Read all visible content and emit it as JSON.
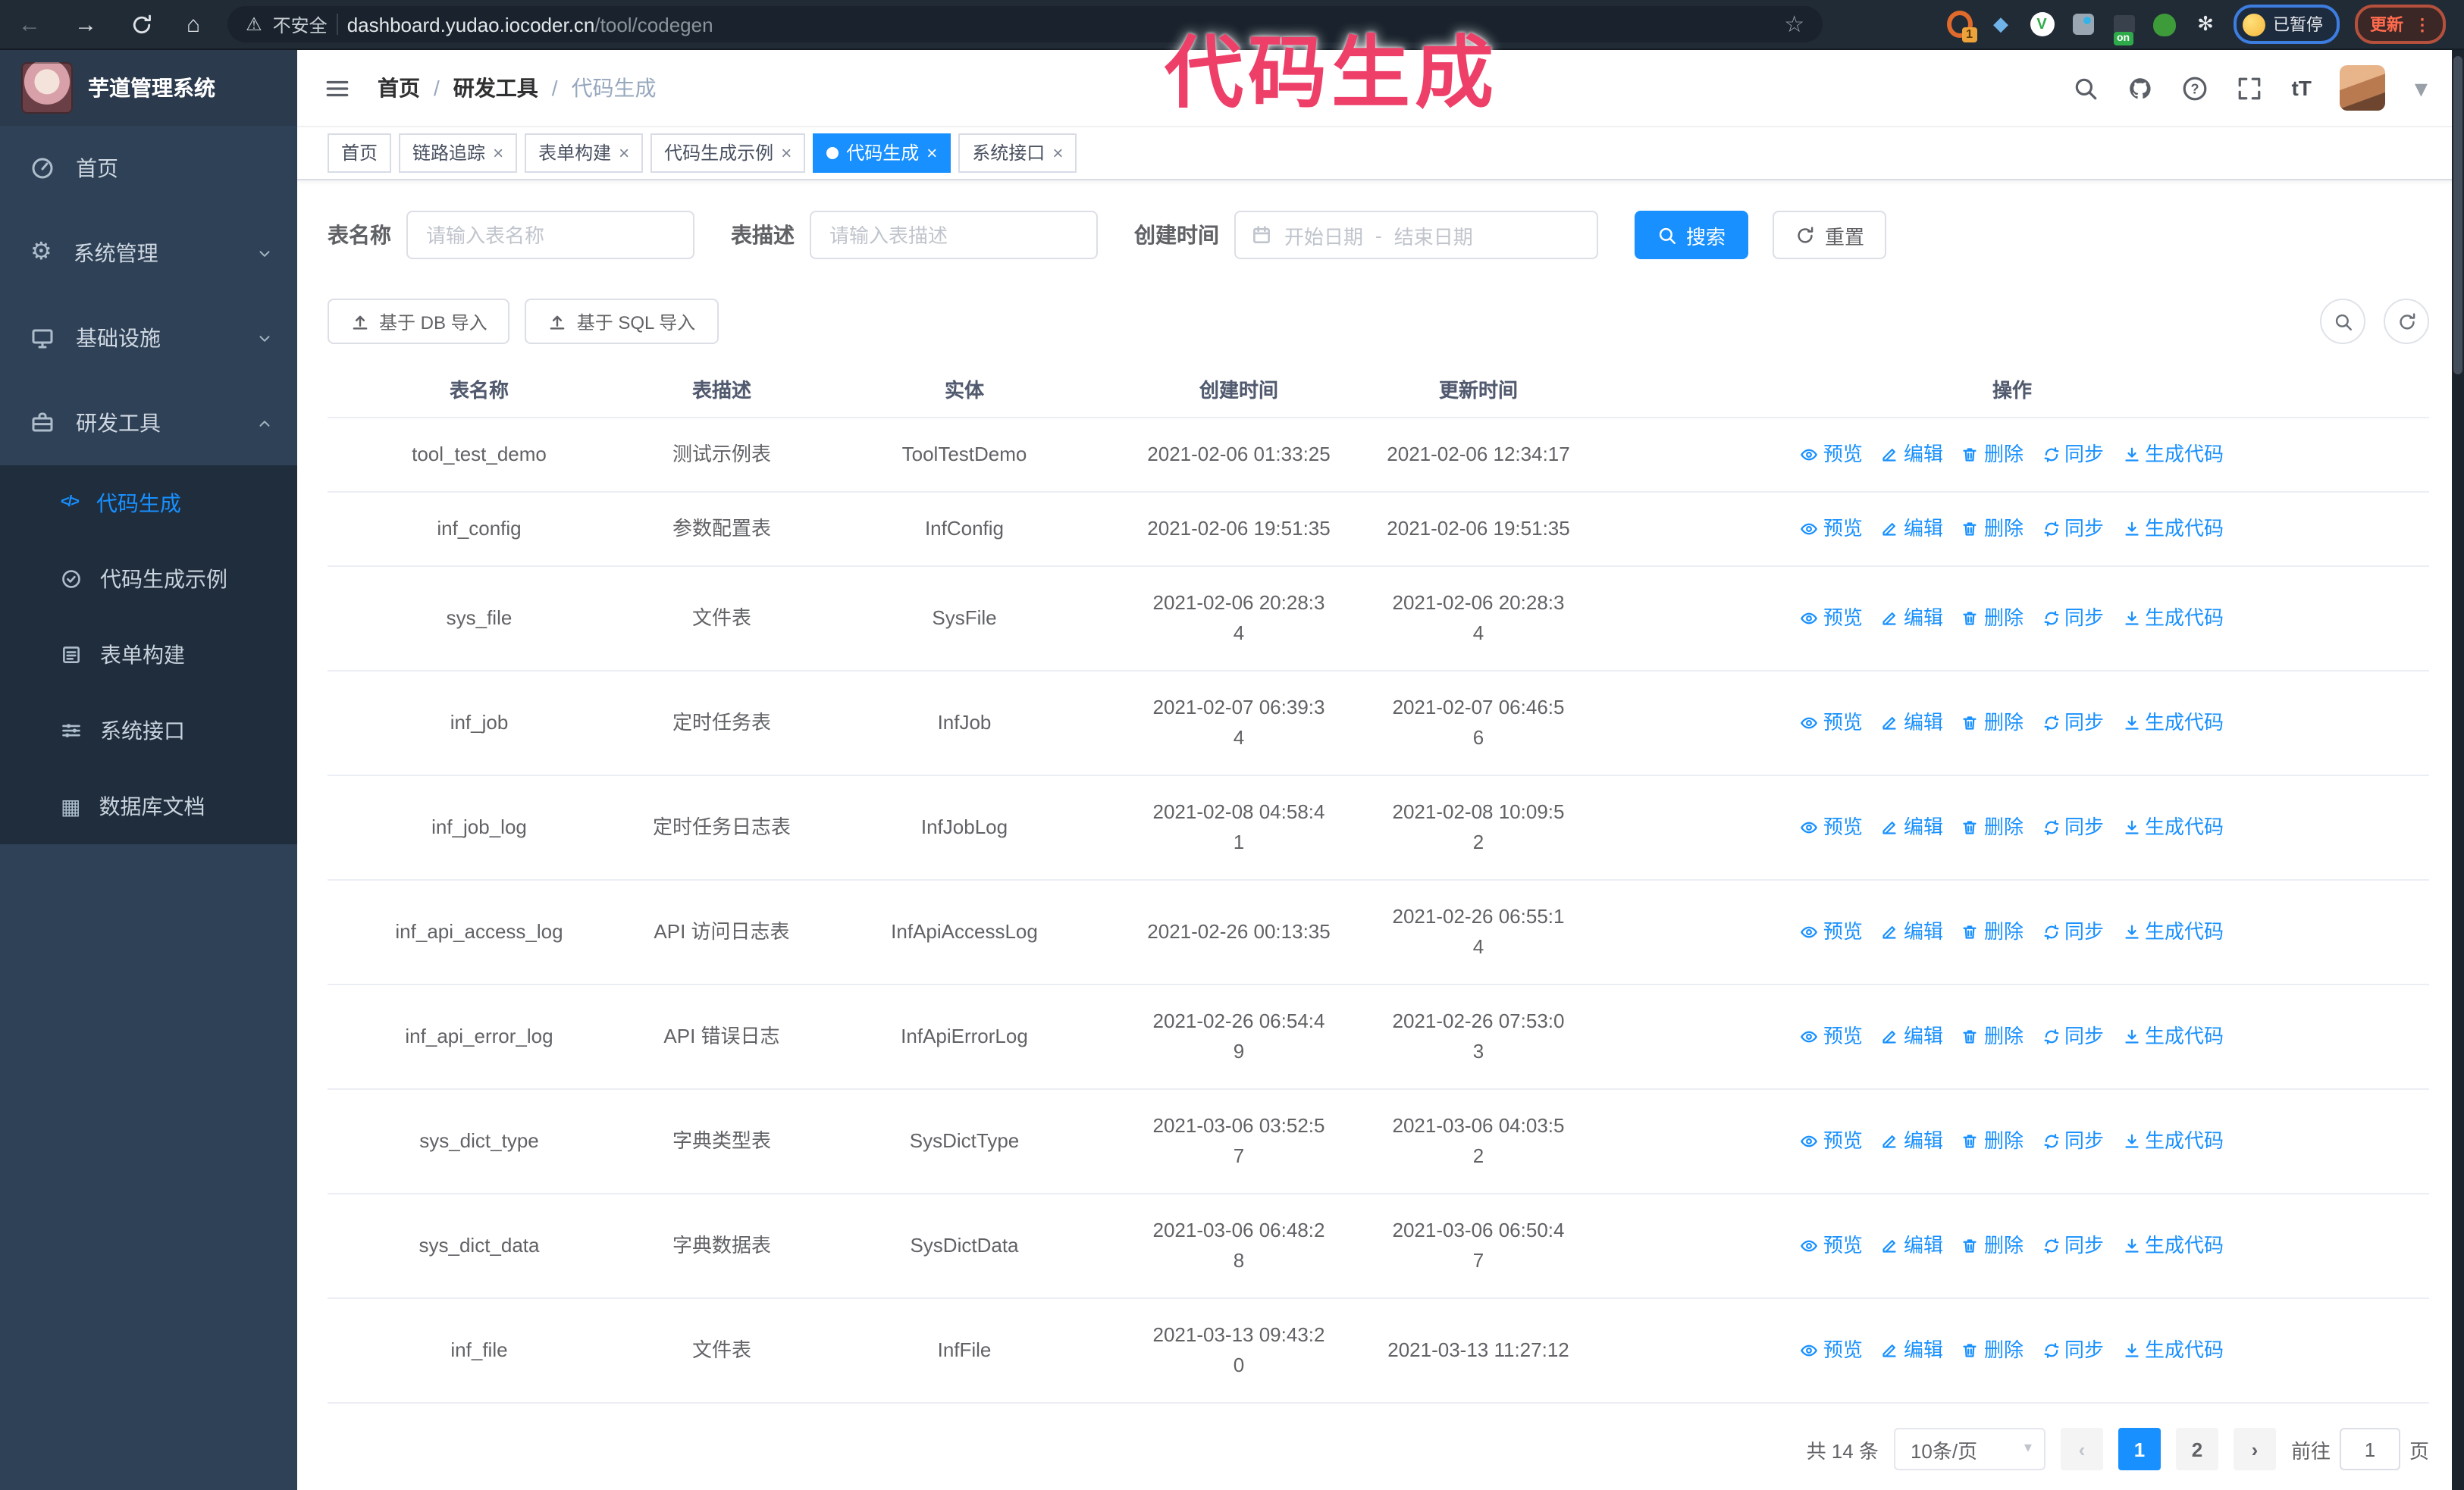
{
  "annotation": {
    "text": "代码生成"
  },
  "ui": {
    "close_symbol": "×",
    "breadcrumb_separator": "/",
    "date_separator": "-"
  },
  "browser": {
    "security_label": "不安全",
    "url_host": "dashboard.yudao.iocoder.cn",
    "url_path": "/tool/codegen",
    "ext_badge": "1",
    "ext_on_badge": "on",
    "paused_badge": "已暂停",
    "update_button": "更新",
    "kebab": "⋮"
  },
  "sidebar": {
    "logo_title": "芋道管理系统",
    "items": [
      {
        "key": "home",
        "label": "首页",
        "icon": "gauge"
      },
      {
        "key": "system",
        "label": "系统管理",
        "icon": "gear",
        "arrow": "down"
      },
      {
        "key": "infra",
        "label": "基础设施",
        "icon": "monitor",
        "arrow": "down"
      },
      {
        "key": "devtools",
        "label": "研发工具",
        "icon": "toolbox",
        "arrow": "up",
        "children": [
          {
            "key": "codegen",
            "label": "代码生成",
            "icon": "code",
            "active": true
          },
          {
            "key": "codegen-example",
            "label": "代码生成示例",
            "icon": "example"
          },
          {
            "key": "form-build",
            "label": "表单构建",
            "icon": "form"
          },
          {
            "key": "system-api",
            "label": "系统接口",
            "icon": "api"
          },
          {
            "key": "db-doc",
            "label": "数据库文档",
            "icon": "dbdoc"
          }
        ]
      }
    ]
  },
  "header": {
    "breadcrumb": [
      "首页",
      "研发工具",
      "代码生成"
    ]
  },
  "tabs": [
    {
      "key": "home",
      "label": "首页",
      "closable": false
    },
    {
      "key": "trace",
      "label": "链路追踪",
      "closable": true
    },
    {
      "key": "form-build",
      "label": "表单构建",
      "closable": true
    },
    {
      "key": "codegen-example",
      "label": "代码生成示例",
      "closable": true
    },
    {
      "key": "codegen",
      "label": "代码生成",
      "closable": true,
      "active": true
    },
    {
      "key": "system-api",
      "label": "系统接口",
      "closable": true
    }
  ],
  "search_form": {
    "table_name": {
      "label": "表名称",
      "placeholder": "请输入表名称"
    },
    "table_desc": {
      "label": "表描述",
      "placeholder": "请输入表描述"
    },
    "create_time": {
      "label": "创建时间",
      "start_placeholder": "开始日期",
      "end_placeholder": "结束日期"
    },
    "search_label": "搜索",
    "reset_label": "重置"
  },
  "toolbar": {
    "import_db_label": "基于 DB 导入",
    "import_sql_label": "基于 SQL 导入"
  },
  "table": {
    "columns": [
      "表名称",
      "表描述",
      "实体",
      "创建时间",
      "更新时间",
      "操作"
    ],
    "actions": [
      {
        "key": "preview",
        "label": "预览",
        "icon": "eye"
      },
      {
        "key": "edit",
        "label": "编辑",
        "icon": "edit"
      },
      {
        "key": "delete",
        "label": "删除",
        "icon": "trash"
      },
      {
        "key": "sync",
        "label": "同步",
        "icon": "sync"
      },
      {
        "key": "generate",
        "label": "生成代码",
        "icon": "download"
      }
    ],
    "rows": [
      {
        "name": "tool_test_demo",
        "desc": "测试示例表",
        "entity": "ToolTestDemo",
        "create_time": [
          "2021-02-06 01:33:25"
        ],
        "update_time": [
          "2021-02-06 12:34:17"
        ]
      },
      {
        "name": "inf_config",
        "desc": "参数配置表",
        "entity": "InfConfig",
        "create_time": [
          "2021-02-06 19:51:35"
        ],
        "update_time": [
          "2021-02-06 19:51:35"
        ]
      },
      {
        "name": "sys_file",
        "desc": "文件表",
        "entity": "SysFile",
        "create_time": [
          "2021-02-06 20:28:3",
          "4"
        ],
        "update_time": [
          "2021-02-06 20:28:3",
          "4"
        ]
      },
      {
        "name": "inf_job",
        "desc": "定时任务表",
        "entity": "InfJob",
        "create_time": [
          "2021-02-07 06:39:3",
          "4"
        ],
        "update_time": [
          "2021-02-07 06:46:5",
          "6"
        ]
      },
      {
        "name": "inf_job_log",
        "desc": "定时任务日志表",
        "entity": "InfJobLog",
        "create_time": [
          "2021-02-08 04:58:4",
          "1"
        ],
        "update_time": [
          "2021-02-08 10:09:5",
          "2"
        ]
      },
      {
        "name": "inf_api_access_log",
        "desc": "API 访问日志表",
        "entity": "InfApiAccessLog",
        "create_time": [
          "2021-02-26 00:13:35"
        ],
        "update_time": [
          "2021-02-26 06:55:1",
          "4"
        ]
      },
      {
        "name": "inf_api_error_log",
        "desc": "API 错误日志",
        "entity": "InfApiErrorLog",
        "create_time": [
          "2021-02-26 06:54:4",
          "9"
        ],
        "update_time": [
          "2021-02-26 07:53:0",
          "3"
        ]
      },
      {
        "name": "sys_dict_type",
        "desc": "字典类型表",
        "entity": "SysDictType",
        "create_time": [
          "2021-03-06 03:52:5",
          "7"
        ],
        "update_time": [
          "2021-03-06 04:03:5",
          "2"
        ]
      },
      {
        "name": "sys_dict_data",
        "desc": "字典数据表",
        "entity": "SysDictData",
        "create_time": [
          "2021-03-06 06:48:2",
          "8"
        ],
        "update_time": [
          "2021-03-06 06:50:4",
          "7"
        ]
      },
      {
        "name": "inf_file",
        "desc": "文件表",
        "entity": "InfFile",
        "create_time": [
          "2021-03-13 09:43:2",
          "0"
        ],
        "update_time": [
          "2021-03-13 11:27:12"
        ]
      }
    ]
  },
  "pagination": {
    "total_label": "共 14 条",
    "page_size_label": "10条/页",
    "prev_symbol": "‹",
    "next_symbol": "›",
    "pages": [
      "1",
      "2"
    ],
    "current": "1",
    "goto_label": "前往",
    "goto_value": "1",
    "page_unit": "页"
  }
}
